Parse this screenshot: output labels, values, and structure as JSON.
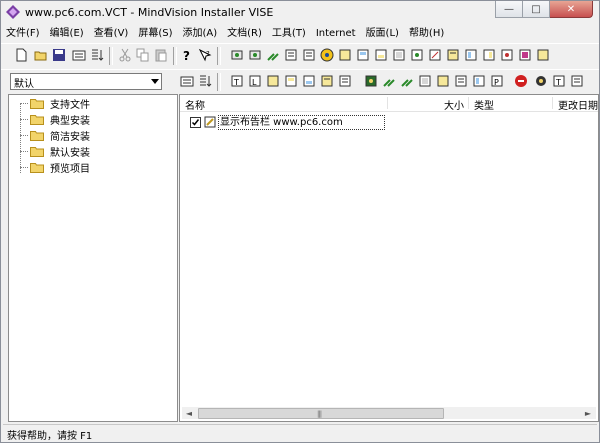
{
  "window": {
    "title": "www.pc6.com.VCT - MindVision Installer VISE"
  },
  "titlebar_buttons": {
    "minimize": "—",
    "maximize": "□",
    "close": "✕"
  },
  "menu": [
    "文件(F)",
    "编辑(E)",
    "查看(V)",
    "屏幕(S)",
    "添加(A)",
    "文档(R)",
    "工具(T)",
    "Internet",
    "版面(L)",
    "帮助(H)"
  ],
  "toolbar_primary": [
    "new-icon",
    "open-icon",
    "save-icon",
    "build-icon",
    "sort-icon",
    "cut-icon",
    "copy-icon",
    "paste-icon",
    "help-icon",
    "pointer-help-icon",
    "group-icon",
    "group-icon",
    "wrench-icon",
    "script-icon",
    "globe-icon",
    "document-icon",
    "document-icon",
    "document-icon",
    "document-icon",
    "document-icon",
    "document-icon",
    "document-icon",
    "document-icon",
    "document-icon",
    "document-icon"
  ],
  "toolbar_secondary": [
    "build-icon",
    "sort-icon",
    "text-icon",
    "document-icon",
    "document-icon",
    "document-icon",
    "document-icon",
    "document-icon",
    "folder-icon",
    "document-icon",
    "document-icon",
    "document-icon",
    "document-icon",
    "document-icon",
    "document-icon",
    "document-icon",
    "document-icon",
    "document-icon",
    "stop-icon",
    "document-icon",
    "text-icon",
    "document-icon"
  ],
  "combo": {
    "value": "默认"
  },
  "tree": {
    "items": [
      {
        "label": "支持文件"
      },
      {
        "label": "典型安装"
      },
      {
        "label": "简洁安装"
      },
      {
        "label": "默认安装"
      },
      {
        "label": "预览项目"
      }
    ]
  },
  "list": {
    "columns": [
      "名称",
      "大小",
      "类型",
      "更改日期"
    ],
    "rows": [
      {
        "checked": true,
        "label": "显示布告栏 www.pc6.com"
      }
    ]
  },
  "scrollbar": {
    "left": "◄",
    "right": "►",
    "grip": "|||"
  },
  "status": {
    "text": "获得帮助，请按 F1"
  },
  "colors": {
    "folder": "#f2d46a",
    "folder_edge": "#b8901c",
    "window_bg": "#f0f0f0",
    "close": "#c75050"
  }
}
